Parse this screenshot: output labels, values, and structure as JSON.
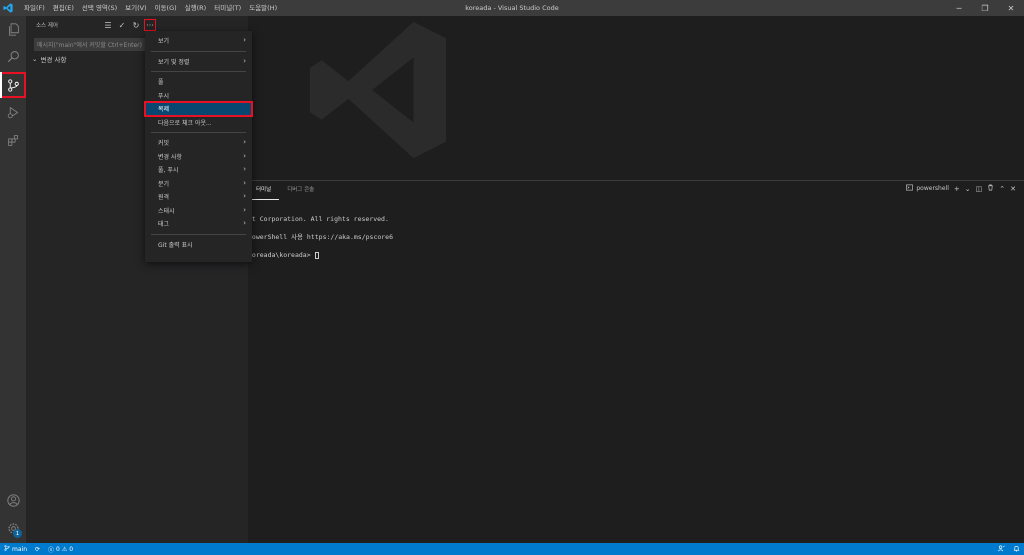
{
  "window": {
    "title": "koreada - Visual Studio Code",
    "menu": [
      "파일(F)",
      "편집(E)",
      "선택 영역(S)",
      "보기(V)",
      "이동(G)",
      "실행(R)",
      "터미널(T)",
      "도움말(H)"
    ],
    "controls": {
      "minimize": "─",
      "restore": "❐",
      "close": "✕"
    }
  },
  "activity_bar": {
    "items": [
      "files-icon",
      "search-icon",
      "source-control-icon",
      "run-debug-icon",
      "extensions-icon"
    ],
    "bottom": [
      "account-icon",
      "settings-gear-icon"
    ],
    "badge": "1"
  },
  "sidebar": {
    "title": "소스 제어",
    "actions": {
      "view_as_tree": "☰",
      "commit": "✓",
      "refresh": "↻",
      "more": "···"
    },
    "commit_placeholder": "메시지(\"main\"에서 커밋할 Ctrl+Enter)",
    "changes_label": "변경 사항"
  },
  "context_menu": {
    "groups": [
      [
        {
          "label": "보기",
          "submenu": true
        }
      ],
      [
        {
          "label": "보기 및 정렬",
          "submenu": true
        }
      ],
      [
        {
          "label": "풀",
          "submenu": false
        },
        {
          "label": "푸시",
          "submenu": false
        },
        {
          "label": "복제",
          "submenu": false
        },
        {
          "label": "다음으로 체크 아웃...",
          "submenu": false
        }
      ],
      [
        {
          "label": "커밋",
          "submenu": true
        },
        {
          "label": "변경 사항",
          "submenu": true
        },
        {
          "label": "풀, 푸시",
          "submenu": true
        },
        {
          "label": "분기",
          "submenu": true
        },
        {
          "label": "원격",
          "submenu": true
        },
        {
          "label": "스태시",
          "submenu": true
        },
        {
          "label": "태그",
          "submenu": true
        }
      ],
      [
        {
          "label": "Git 출력 표시",
          "submenu": false
        }
      ]
    ],
    "highlighted": "복제"
  },
  "panel": {
    "tabs": [
      "터미널",
      "디버그 콘솔"
    ],
    "active_tab": "터미널",
    "shell": "powershell",
    "tools": {
      "add": "+",
      "dropdown": "⌄",
      "split": "◫",
      "kill": "🗑",
      "maximize": "⌃",
      "close": "✕"
    },
    "terminal_lines": [
      "ft Corporation. All rights reserved.",
      "PowerShell 사용 https://aka.ms/pscore6",
      "koreada\\koreada> "
    ]
  },
  "statusbar": {
    "branch": "main",
    "sync": "⟳",
    "errors": "0",
    "warnings": "0"
  },
  "colors": {
    "accent": "#007acc",
    "highlight_outline": "#e81123",
    "menu_selection": "#094771"
  }
}
